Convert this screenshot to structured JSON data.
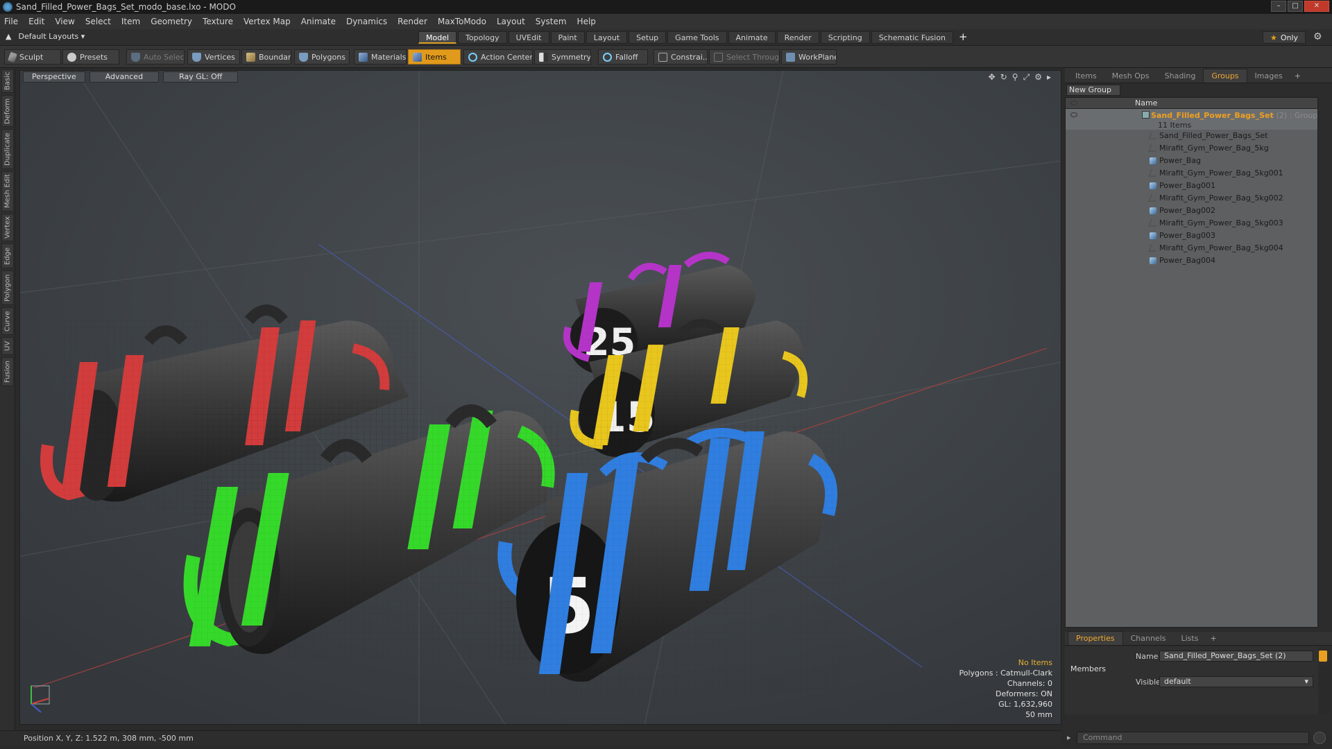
{
  "window": {
    "title": "Sand_Filled_Power_Bags_Set_modo_base.lxo - MODO"
  },
  "menu": [
    "File",
    "Edit",
    "View",
    "Select",
    "Item",
    "Geometry",
    "Texture",
    "Vertex Map",
    "Animate",
    "Dynamics",
    "Render",
    "MaxToModo",
    "Layout",
    "System",
    "Help"
  ],
  "layouts": {
    "label": "Default Layouts ▾"
  },
  "layout_tabs": [
    {
      "label": "Model",
      "active": true
    },
    {
      "label": "Topology"
    },
    {
      "label": "UVEdit"
    },
    {
      "label": "Paint"
    },
    {
      "label": "Layout"
    },
    {
      "label": "Setup"
    },
    {
      "label": "Game Tools"
    },
    {
      "label": "Animate"
    },
    {
      "label": "Render"
    },
    {
      "label": "Scripting"
    },
    {
      "label": "Schematic Fusion"
    }
  ],
  "only_label": "Only",
  "toolbar": {
    "sculpt": "Sculpt",
    "presets": "Presets",
    "auto_select": "Auto Select",
    "vertices": "Vertices",
    "boundary": "Boundary",
    "polygons": "Polygons",
    "materials": "Materials",
    "items": "Items",
    "action_center": "Action Center",
    "symmetry": "Symmetry",
    "falloff": "Falloff",
    "constraints": "Constrai...",
    "select_through": "Select Through",
    "workplane": "WorkPlane"
  },
  "left_tabs": [
    "Basic",
    "Deform",
    "Duplicate",
    "Mesh Edit",
    "Vertex",
    "Edge",
    "Polygon",
    "Curve",
    "UV",
    "Fusion"
  ],
  "viewport": {
    "perspective": "Perspective",
    "advanced": "Advanced",
    "raygl": "Ray GL: Off",
    "stats": {
      "no_items": "No Items",
      "polygons": "Polygons : Catmull-Clark",
      "channels": "Channels: 0",
      "deformers": "Deformers: ON",
      "gl": "GL: 1,632,960",
      "scale": "50 mm"
    },
    "bag_numbers": [
      "25",
      "15",
      "5"
    ]
  },
  "panel_tabs": [
    {
      "label": "Items"
    },
    {
      "label": "Mesh Ops"
    },
    {
      "label": "Shading"
    },
    {
      "label": "Groups",
      "active": true
    },
    {
      "label": "Images"
    }
  ],
  "groups": {
    "new_group": "New Group",
    "col_name": "Name",
    "group_name": "Sand_Filled_Power_Bags_Set",
    "group_suffix": "(2) : Group",
    "item_count": "11 Items",
    "items": [
      {
        "label": "Sand_Filled_Power_Bags_Set",
        "kind": "locator"
      },
      {
        "label": "Mirafit_Gym_Power_Bag_5kg",
        "kind": "locator"
      },
      {
        "label": "Power_Bag",
        "kind": "mesh"
      },
      {
        "label": "Mirafit_Gym_Power_Bag_5kg001",
        "kind": "locator"
      },
      {
        "label": "Power_Bag001",
        "kind": "mesh"
      },
      {
        "label": "Mirafit_Gym_Power_Bag_5kg002",
        "kind": "locator"
      },
      {
        "label": "Power_Bag002",
        "kind": "mesh"
      },
      {
        "label": "Mirafit_Gym_Power_Bag_5kg003",
        "kind": "locator"
      },
      {
        "label": "Power_Bag003",
        "kind": "mesh"
      },
      {
        "label": "Mirafit_Gym_Power_Bag_5kg004",
        "kind": "locator"
      },
      {
        "label": "Power_Bag004",
        "kind": "mesh"
      }
    ]
  },
  "props_tabs": [
    {
      "label": "Properties",
      "active": true
    },
    {
      "label": "Channels"
    },
    {
      "label": "Lists"
    }
  ],
  "properties": {
    "name_label": "Name",
    "name_value": "Sand_Filled_Power_Bags_Set (2)",
    "members": "Members",
    "visible_label": "Visible",
    "visible_value": "default"
  },
  "status": {
    "position": "Position X, Y, Z:  1.522 m, 308 mm, -500 mm"
  },
  "command": {
    "placeholder": "Command"
  },
  "colors": {
    "accent": "#e29a1c",
    "red_bag": "#d23c3c",
    "green_bag": "#35d92a",
    "blue_bag": "#2f7ee0",
    "yellow_bag": "#e8c61e",
    "purple_bag": "#b434c8"
  }
}
